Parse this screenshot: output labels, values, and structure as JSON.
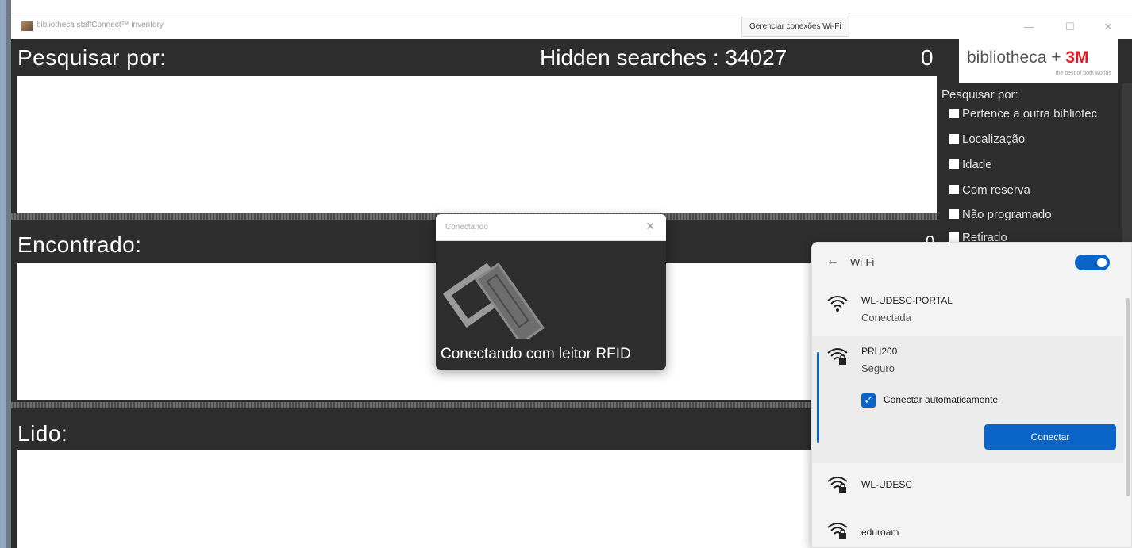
{
  "window": {
    "title": "bibliotheca staffConnect™ inventory",
    "wifi_tooltip": "Gerenciar conexões Wi-Fi",
    "minimize": "—",
    "maximize": "☐",
    "close": "✕"
  },
  "search": {
    "label": "Pesquisar por:",
    "hidden_searches": "Hidden searches : 34027",
    "count": "0"
  },
  "found": {
    "label": "Encontrado:",
    "count": "0"
  },
  "read": {
    "label": "Lido:"
  },
  "logo": {
    "brand": "bibliotheca",
    "plus": " + ",
    "partner": "3M",
    "tagline": "the best of both worlds"
  },
  "filters": {
    "title": "Pesquisar por:",
    "items": [
      "Pertence a outra bibliotec",
      "Localização",
      "Idade",
      "Com reserva",
      "Não programado",
      "Retirado"
    ]
  },
  "dialog": {
    "title": "Conectando",
    "close": "✕",
    "message": "Conectando com leitor RFID"
  },
  "wifi": {
    "back": "←",
    "title": "Wi-Fi",
    "enabled": true,
    "networks": [
      {
        "name": "WL-UDESC-PORTAL",
        "status": "Conectada",
        "secured": false
      },
      {
        "name": "PRH200",
        "status": "Seguro",
        "secured": true
      },
      {
        "name": "WL-UDESC",
        "status": "",
        "secured": true
      },
      {
        "name": "eduroam",
        "status": "",
        "secured": true
      }
    ],
    "auto_connect_label": "Conectar automaticamente",
    "auto_connect_checked": true,
    "connect_button": "Conectar",
    "accent": "#0a64c8"
  }
}
